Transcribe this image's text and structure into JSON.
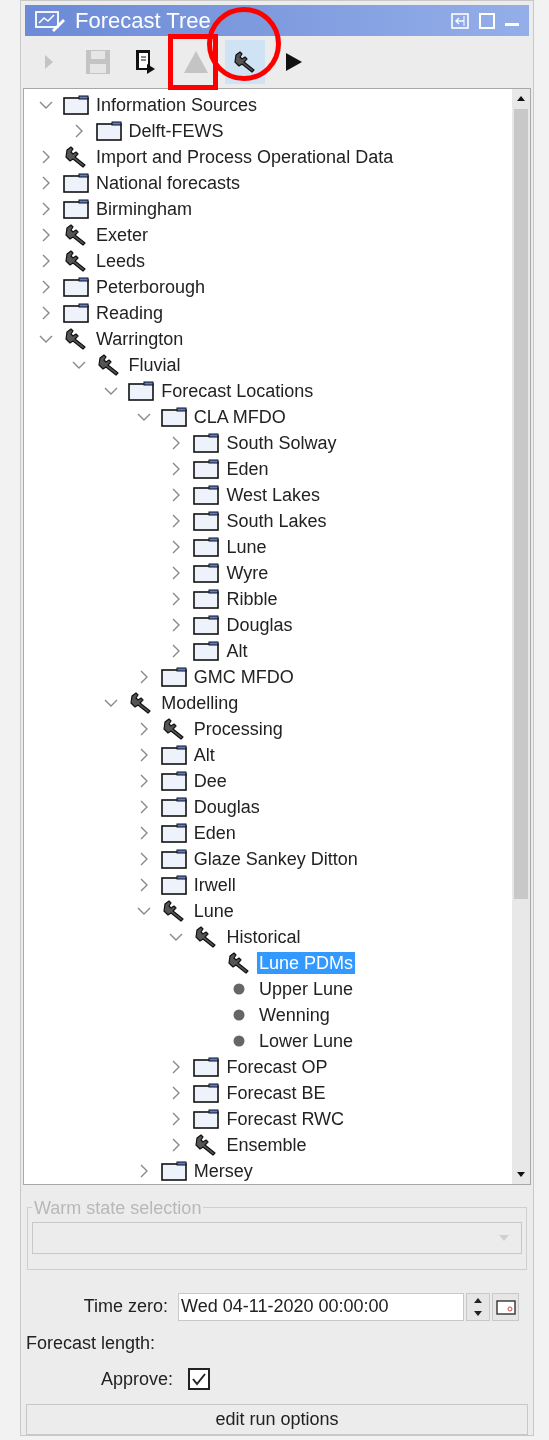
{
  "window": {
    "title": "Forecast Tree"
  },
  "toolbar": [
    {
      "kind": "run",
      "disabled": true,
      "selected": false
    },
    {
      "kind": "save",
      "disabled": true,
      "selected": false
    },
    {
      "kind": "export",
      "disabled": false,
      "selected": false
    },
    {
      "kind": "triangle",
      "disabled": true,
      "selected": false,
      "annotation": {
        "kind": "rectangle"
      }
    },
    {
      "kind": "wrench",
      "disabled": false,
      "selected": true,
      "annotation": {
        "kind": "circle"
      }
    },
    {
      "kind": "play",
      "disabled": false,
      "selected": false
    }
  ],
  "tree": [
    {
      "label": "Information Sources",
      "kind": "folder",
      "expanded": true,
      "selected": false,
      "children": [
        {
          "label": "Delft-FEWS",
          "kind": "folder",
          "expanded": false,
          "selected": false
        }
      ]
    },
    {
      "label": "Import and Process Operational Data",
      "kind": "tool",
      "expanded": false,
      "selected": false
    },
    {
      "label": "National forecasts",
      "kind": "folder",
      "expanded": false,
      "selected": false
    },
    {
      "label": "Birmingham",
      "kind": "folder",
      "expanded": false,
      "selected": false
    },
    {
      "label": "Exeter",
      "kind": "tool",
      "expanded": false,
      "selected": false
    },
    {
      "label": "Leeds",
      "kind": "tool",
      "expanded": false,
      "selected": false
    },
    {
      "label": "Peterborough",
      "kind": "folder",
      "expanded": false,
      "selected": false
    },
    {
      "label": "Reading",
      "kind": "folder",
      "expanded": false,
      "selected": false
    },
    {
      "label": "Warrington",
      "kind": "tool",
      "expanded": true,
      "selected": false,
      "children": [
        {
          "label": "Fluvial",
          "kind": "tool",
          "expanded": true,
          "selected": false,
          "children": [
            {
              "label": "Forecast Locations",
              "kind": "folder",
              "expanded": true,
              "selected": false,
              "children": [
                {
                  "label": "CLA MFDO",
                  "kind": "folder",
                  "expanded": true,
                  "selected": false,
                  "children": [
                    {
                      "label": "South Solway",
                      "kind": "folder",
                      "expanded": false,
                      "selected": false
                    },
                    {
                      "label": "Eden",
                      "kind": "folder",
                      "expanded": false,
                      "selected": false
                    },
                    {
                      "label": "West Lakes",
                      "kind": "folder",
                      "expanded": false,
                      "selected": false
                    },
                    {
                      "label": "South Lakes",
                      "kind": "folder",
                      "expanded": false,
                      "selected": false
                    },
                    {
                      "label": "Lune",
                      "kind": "folder",
                      "expanded": false,
                      "selected": false
                    },
                    {
                      "label": "Wyre",
                      "kind": "folder",
                      "expanded": false,
                      "selected": false
                    },
                    {
                      "label": "Ribble",
                      "kind": "folder",
                      "expanded": false,
                      "selected": false
                    },
                    {
                      "label": "Douglas",
                      "kind": "folder",
                      "expanded": false,
                      "selected": false
                    },
                    {
                      "label": "Alt",
                      "kind": "folder",
                      "expanded": false,
                      "selected": false
                    }
                  ]
                },
                {
                  "label": "GMC MFDO",
                  "kind": "folder",
                  "expanded": false,
                  "selected": false
                }
              ]
            },
            {
              "label": "Modelling",
              "kind": "tool",
              "expanded": true,
              "selected": false,
              "children": [
                {
                  "label": "Processing",
                  "kind": "tool",
                  "expanded": false,
                  "selected": false
                },
                {
                  "label": "Alt",
                  "kind": "folder",
                  "expanded": false,
                  "selected": false
                },
                {
                  "label": "Dee",
                  "kind": "folder",
                  "expanded": false,
                  "selected": false
                },
                {
                  "label": "Douglas",
                  "kind": "folder",
                  "expanded": false,
                  "selected": false
                },
                {
                  "label": "Eden",
                  "kind": "folder",
                  "expanded": false,
                  "selected": false
                },
                {
                  "label": "Glaze Sankey Ditton",
                  "kind": "folder",
                  "expanded": false,
                  "selected": false
                },
                {
                  "label": "Irwell",
                  "kind": "folder",
                  "expanded": false,
                  "selected": false
                },
                {
                  "label": "Lune",
                  "kind": "tool",
                  "expanded": true,
                  "selected": false,
                  "children": [
                    {
                      "label": "Historical",
                      "kind": "tool",
                      "expanded": true,
                      "selected": false,
                      "children": [
                        {
                          "label": "Lune PDMs",
                          "kind": "tool",
                          "selected": true
                        },
                        {
                          "label": "Upper Lune",
                          "kind": "item",
                          "selected": false
                        },
                        {
                          "label": "Wenning",
                          "kind": "item",
                          "selected": false
                        },
                        {
                          "label": "Lower Lune",
                          "kind": "item",
                          "selected": false
                        }
                      ]
                    },
                    {
                      "label": "Forecast OP",
                      "kind": "folder",
                      "expanded": false,
                      "selected": false
                    },
                    {
                      "label": "Forecast BE",
                      "kind": "folder",
                      "expanded": false,
                      "selected": false
                    },
                    {
                      "label": "Forecast RWC",
                      "kind": "folder",
                      "expanded": false,
                      "selected": false
                    },
                    {
                      "label": "Ensemble",
                      "kind": "tool",
                      "expanded": false,
                      "selected": false
                    }
                  ]
                },
                {
                  "label": "Mersey",
                  "kind": "folder",
                  "expanded": false,
                  "selected": false
                }
              ]
            }
          ]
        }
      ]
    }
  ],
  "warm_state": {
    "label": "Warm state selection",
    "disabled": true
  },
  "time_zero": {
    "label": "Time zero:",
    "value": "Wed 04-11-2020 00:00:00"
  },
  "forecast_length": {
    "label": "Forecast length:"
  },
  "approve": {
    "label": "Approve:",
    "checked": true
  },
  "run_options_button": "edit run options"
}
